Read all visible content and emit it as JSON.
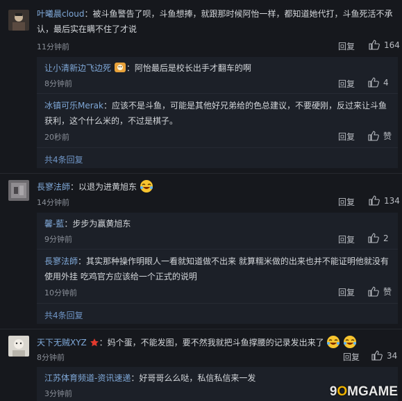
{
  "ui": {
    "reply": "回复",
    "thumb_icon": "thumbs-up-icon"
  },
  "comments": [
    {
      "user": "叶曦晨cloud",
      "text_line1": "：被斗鱼警告了呗，斗鱼想捧，就跟那时候阿怡一样，都知道她代打，斗鱼死活不承",
      "text_line2": "认，最后实在瞒不住了才说",
      "time": "11分钟前",
      "likes": "164",
      "replies": [
        {
          "user": "让小清新边飞边死",
          "text": "：阿怡最后是校长出手才翻车的啊",
          "time": "8分钟前",
          "likes": "4"
        },
        {
          "user": "冰镇可乐Merak",
          "text_line1": "：应该不是斗鱼，可能是其他好兄弟给的色总建议，不要硬刚，反过来让斗鱼",
          "text_line2": "获利，这个什么米的，不过是棋子。",
          "time": "20秒前",
          "likes": "赞"
        }
      ],
      "more": "共4条回复"
    },
    {
      "user": "長寥法師",
      "text": "：以退为进黄旭东",
      "time": "14分钟前",
      "likes": "134",
      "replies": [
        {
          "user": "馨-藍",
          "text": "：步步为赢黄旭东",
          "time": "9分钟前",
          "likes": "2"
        },
        {
          "user": "長寥法師",
          "text_line1": "：其实那种操作明眼人一看就知道做不出来 就算糯米做的出来也并不能证明他就没有",
          "text_line2": "使用外挂 吃鸡官方应该给一个正式的说明",
          "time": "10分钟前",
          "likes": "赞"
        }
      ],
      "more": "共4条回复"
    },
    {
      "user": "天下无贼XYZ",
      "text": "：妈个蛋，不能发图，要不然我就把斗鱼撑腰的记录发出来了",
      "time": "8分钟前",
      "likes": "34",
      "replies": [
        {
          "user": "江苏体育频道-资讯速递",
          "text": "：好哥哥么么哒，私信私信来一发",
          "time": "3分钟前"
        }
      ]
    }
  ],
  "watermark": {
    "prefix": "9",
    "o": "O",
    "suffix": "MGAME"
  }
}
